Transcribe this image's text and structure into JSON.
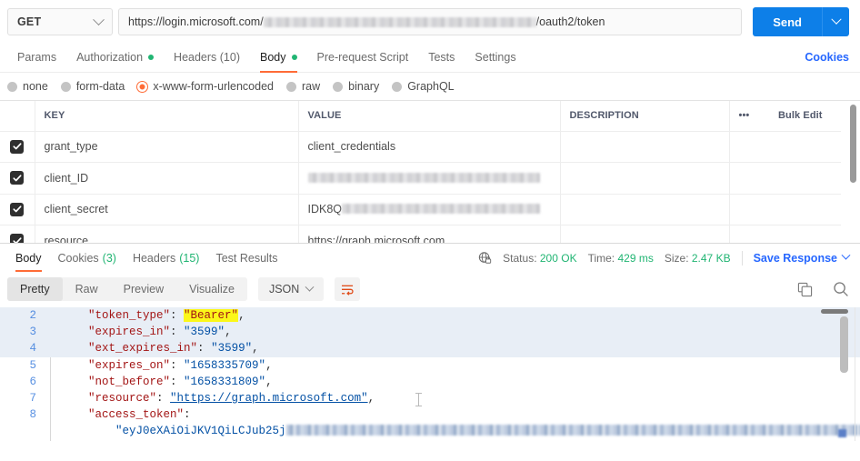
{
  "request": {
    "method": "GET",
    "url_prefix": "https://login.microsoft.com/",
    "url_suffix": "/oauth2/token",
    "send_label": "Send",
    "cookies_link": "Cookies",
    "tabs": [
      {
        "label": "Params",
        "dot": false,
        "active": false
      },
      {
        "label": "Authorization",
        "dot": true,
        "active": false
      },
      {
        "label": "Headers (10)",
        "dot": false,
        "active": false
      },
      {
        "label": "Body",
        "dot": true,
        "active": true
      },
      {
        "label": "Pre-request Script",
        "dot": false,
        "active": false
      },
      {
        "label": "Tests",
        "dot": false,
        "active": false
      },
      {
        "label": "Settings",
        "dot": false,
        "active": false
      }
    ],
    "body_types": [
      {
        "label": "none",
        "selected": false
      },
      {
        "label": "form-data",
        "selected": false
      },
      {
        "label": "x-www-form-urlencoded",
        "selected": true
      },
      {
        "label": "raw",
        "selected": false
      },
      {
        "label": "binary",
        "selected": false
      },
      {
        "label": "GraphQL",
        "selected": false
      }
    ],
    "table": {
      "headers": [
        "KEY",
        "VALUE",
        "DESCRIPTION"
      ],
      "more_label": "•••",
      "bulk_edit_label": "Bulk Edit",
      "rows": [
        {
          "checked": true,
          "key": "grant_type",
          "value": "client_credentials",
          "redacted": false,
          "description": ""
        },
        {
          "checked": true,
          "key": "client_ID",
          "value": "",
          "redacted": true,
          "description": ""
        },
        {
          "checked": true,
          "key": "client_secret",
          "value": "IDK8Q",
          "redacted": true,
          "description": ""
        },
        {
          "checked": true,
          "key": "resource",
          "value": "https://graph.microsoft.com",
          "redacted": false,
          "description": ""
        }
      ]
    }
  },
  "response": {
    "tabs": [
      {
        "label": "Body",
        "count": "",
        "active": true
      },
      {
        "label": "Cookies",
        "count": "(3)",
        "active": false
      },
      {
        "label": "Headers",
        "count": "(15)",
        "active": false
      },
      {
        "label": "Test Results",
        "count": "",
        "active": false
      }
    ],
    "status_label": "Status:",
    "status_value": "200 OK",
    "time_label": "Time:",
    "time_value": "429 ms",
    "size_label": "Size:",
    "size_value": "2.47 KB",
    "save_response_label": "Save Response",
    "viewer_modes": [
      {
        "label": "Pretty",
        "active": true
      },
      {
        "label": "Raw",
        "active": false
      },
      {
        "label": "Preview",
        "active": false
      },
      {
        "label": "Visualize",
        "active": false
      }
    ],
    "format": "JSON",
    "body_lines": [
      {
        "num": "2",
        "highlight": true,
        "key": "\"token_type\"",
        "value": "\"Bearer\"",
        "value_kind": "marked",
        "comma": ","
      },
      {
        "num": "3",
        "highlight": true,
        "key": "\"expires_in\"",
        "value": "\"3599\"",
        "value_kind": "string",
        "comma": ","
      },
      {
        "num": "4",
        "highlight": true,
        "key": "\"ext_expires_in\"",
        "value": "\"3599\"",
        "value_kind": "string",
        "comma": ","
      },
      {
        "num": "5",
        "highlight": false,
        "key": "\"expires_on\"",
        "value": "\"1658335709\"",
        "value_kind": "string",
        "comma": ","
      },
      {
        "num": "6",
        "highlight": false,
        "key": "\"not_before\"",
        "value": "\"1658331809\"",
        "value_kind": "string",
        "comma": ","
      },
      {
        "num": "7",
        "highlight": false,
        "key": "\"resource\"",
        "value": "\"https://graph.microsoft.com\"",
        "value_kind": "link",
        "comma": ","
      },
      {
        "num": "8",
        "highlight": false,
        "key": "\"access_token\"",
        "value": "",
        "value_kind": "none",
        "comma": ""
      }
    ],
    "jwt_prefix": "\"eyJ0eXAiOiJKV1QiLCJub25j"
  },
  "colors": {
    "accent_orange": "#ff6c37",
    "send_blue": "#0d7fe8",
    "link_blue": "#2667ff",
    "status_green": "#21b573",
    "highlight_yellow": "#fbf719"
  }
}
